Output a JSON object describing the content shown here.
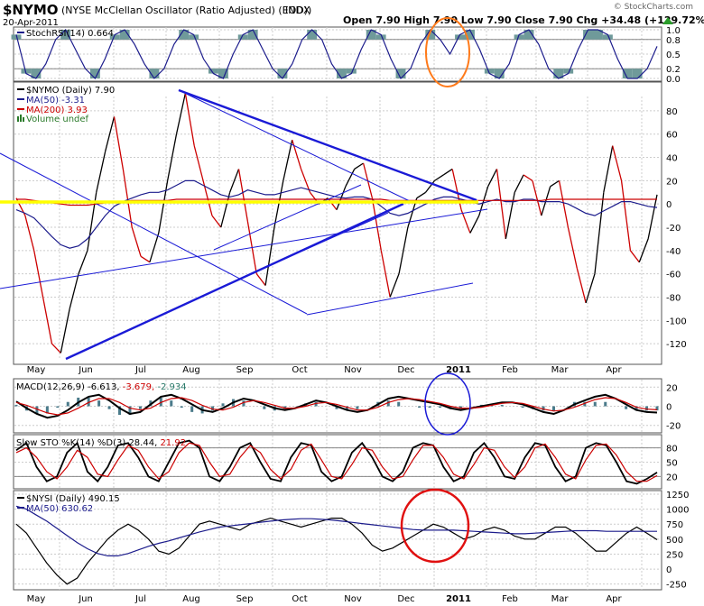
{
  "header": {
    "symbol": "$NYMO",
    "description": "(NYSE McClellan Oscillator (Ratio Adjusted) (EOD))",
    "exchange": "INDX",
    "date": "20-Apr-2011",
    "quote": "Open 7.90  High 7.90  Low 7.90  Close 7.90  Chg +34.48 (+129.72%)",
    "watermark": "© StockCharts.com",
    "up_arrow_color": "#2a9d2a"
  },
  "x_axis": {
    "months": [
      "May",
      "Jun",
      "Jul",
      "Aug",
      "Sep",
      "Oct",
      "Nov",
      "Dec",
      "2011",
      "Feb",
      "Mar",
      "Apr"
    ]
  },
  "panels": {
    "stochrsi": {
      "legend": "StochRSI(14) 0.664",
      "ticks": [
        "1.0",
        "0.8",
        "0.5",
        "0.2",
        "0.0"
      ]
    },
    "nymo": {
      "legend_main": "$NYMO (Daily) 7.90",
      "legend_ma50": "MA(50) -3.31",
      "legend_ma200": "MA(200) 3.93",
      "legend_volume": "Volume undef",
      "ticks": [
        "80",
        "60",
        "40",
        "20",
        "0",
        "-20",
        "-40",
        "-60",
        "-80",
        "-100",
        "-120"
      ]
    },
    "macd": {
      "legend_prefix": "MACD(12,26,9)",
      "legend_v1": "-6.613,",
      "legend_v2": "-3.679,",
      "legend_v3": "-2.934",
      "ticks": [
        "20",
        "0",
        "-20"
      ]
    },
    "sto": {
      "legend_prefix": "Slow STO %K(14) %D(3)",
      "legend_k": "28.44,",
      "legend_d": "21.92",
      "ticks": [
        "80",
        "50",
        "20"
      ]
    },
    "nysi": {
      "legend_main": "$NYSI (Daily) 490.15",
      "legend_ma": "MA(50) 630.62",
      "ticks": [
        "1250",
        "1000",
        "750",
        "500",
        "250",
        "0",
        "-250"
      ]
    }
  },
  "colors": {
    "price": "#000000",
    "ma50": "#1c1c8c",
    "ma200": "#cc0000",
    "trendline": "#1a1ad6",
    "zero_line": "#ffff00",
    "stoch_fill": "#6f9a9a",
    "macd_hist": "#4a7a8a",
    "circle_orange": "#ff7a1a",
    "circle_blue": "#1a1ad6",
    "circle_red": "#e01010"
  },
  "chart_data": [
    {
      "type": "line",
      "title": "StochRSI(14)",
      "ylim": [
        0,
        1
      ],
      "series": [
        {
          "name": "StochRSI(14)",
          "values": [
            0.9,
            0.1,
            0.0,
            0.3,
            0.8,
            1.0,
            0.6,
            0.2,
            0.0,
            0.4,
            0.9,
            1.0,
            0.7,
            0.3,
            0.0,
            0.2,
            0.7,
            1.0,
            0.9,
            0.4,
            0.1,
            0.0,
            0.5,
            0.9,
            1.0,
            0.6,
            0.2,
            0.0,
            0.3,
            0.8,
            1.0,
            0.8,
            0.3,
            0.0,
            0.1,
            0.6,
            1.0,
            0.9,
            0.4,
            0.0,
            0.2,
            0.7,
            1.0,
            0.8,
            0.5,
            0.9,
            1.0,
            0.6,
            0.1,
            0.0,
            0.3,
            0.9,
            1.0,
            0.7,
            0.2,
            0.0,
            0.1,
            0.6,
            1.0,
            1.0,
            0.9,
            0.4,
            0.0,
            0.0,
            0.2,
            0.66
          ]
        }
      ]
    },
    {
      "type": "line",
      "title": "$NYMO (Daily)",
      "ylim": [
        -130,
        90
      ],
      "series": [
        {
          "name": "$NYMO",
          "values": [
            5,
            -10,
            -40,
            -80,
            -120,
            -128,
            -90,
            -60,
            -40,
            10,
            45,
            75,
            30,
            -20,
            -45,
            -50,
            -25,
            20,
            60,
            95,
            50,
            20,
            -10,
            -20,
            10,
            30,
            -15,
            -60,
            -70,
            -20,
            20,
            55,
            30,
            10,
            0,
            5,
            -5,
            15,
            30,
            35,
            5,
            -40,
            -80,
            -60,
            -20,
            5,
            10,
            20,
            25,
            30,
            -5,
            -25,
            -10,
            15,
            30,
            -30,
            10,
            25,
            20,
            -10,
            15,
            20,
            -20,
            -55,
            -85,
            -60,
            10,
            50,
            20,
            -40,
            -50,
            -30,
            8
          ]
        },
        {
          "name": "MA(50)",
          "values": [
            -5,
            -8,
            -12,
            -20,
            -28,
            -35,
            -38,
            -36,
            -30,
            -20,
            -10,
            -2,
            2,
            5,
            8,
            10,
            10,
            12,
            16,
            20,
            20,
            16,
            12,
            8,
            6,
            8,
            12,
            10,
            8,
            8,
            10,
            12,
            14,
            12,
            10,
            8,
            6,
            5,
            6,
            6,
            4,
            -2,
            -8,
            -10,
            -8,
            -4,
            0,
            4,
            6,
            6,
            4,
            2,
            0,
            2,
            4,
            2,
            2,
            4,
            4,
            2,
            2,
            2,
            0,
            -4,
            -8,
            -10,
            -6,
            -2,
            2,
            2,
            0,
            -2,
            -3
          ]
        },
        {
          "name": "MA(200)",
          "values": [
            4,
            4,
            3,
            2,
            1,
            0,
            -1,
            -1,
            -1,
            0,
            1,
            2,
            2,
            3,
            3,
            3,
            3,
            3,
            4,
            4,
            4,
            4,
            4,
            4,
            4,
            4,
            4,
            4,
            4,
            4,
            4,
            4,
            4,
            4,
            4,
            4,
            4,
            4,
            4,
            4,
            4,
            4,
            3,
            3,
            3,
            3,
            3,
            3,
            3,
            3,
            3,
            3,
            3,
            3,
            3,
            3,
            3,
            3,
            3,
            3,
            4,
            4,
            4,
            4,
            4,
            4,
            4,
            4,
            4,
            4,
            4,
            4,
            4
          ]
        }
      ]
    },
    {
      "type": "line",
      "title": "MACD(12,26,9)",
      "ylim": [
        -25,
        25
      ],
      "series": [
        {
          "name": "MACD",
          "values": [
            5,
            -2,
            -8,
            -12,
            -10,
            -4,
            4,
            10,
            12,
            6,
            -2,
            -8,
            -6,
            2,
            10,
            12,
            8,
            2,
            -4,
            -6,
            -2,
            4,
            8,
            6,
            2,
            -2,
            -4,
            -2,
            2,
            6,
            4,
            0,
            -4,
            -6,
            -4,
            2,
            8,
            10,
            8,
            6,
            4,
            2,
            -2,
            -4,
            -2,
            0,
            2,
            4,
            4,
            2,
            -2,
            -6,
            -8,
            -4,
            2,
            6,
            10,
            12,
            8,
            2,
            -4,
            -6,
            -6.6
          ]
        },
        {
          "name": "Signal",
          "values": [
            4,
            1,
            -3,
            -7,
            -9,
            -7,
            -2,
            4,
            8,
            8,
            4,
            -2,
            -4,
            -2,
            4,
            8,
            9,
            6,
            1,
            -3,
            -4,
            -1,
            4,
            6,
            4,
            1,
            -2,
            -2,
            0,
            3,
            4,
            2,
            -1,
            -4,
            -4,
            -1,
            4,
            7,
            8,
            7,
            5,
            3,
            0,
            -2,
            -2,
            -1,
            1,
            3,
            4,
            3,
            0,
            -3,
            -5,
            -4,
            -1,
            3,
            7,
            9,
            8,
            4,
            -1,
            -3,
            -3.7
          ]
        }
      ]
    },
    {
      "type": "line",
      "title": "Slow STO %K(14) %D(3)",
      "ylim": [
        0,
        100
      ],
      "series": [
        {
          "name": "%K",
          "values": [
            75,
            90,
            40,
            10,
            20,
            70,
            90,
            30,
            10,
            40,
            85,
            90,
            60,
            20,
            10,
            50,
            90,
            95,
            80,
            20,
            10,
            40,
            80,
            90,
            50,
            15,
            10,
            60,
            90,
            85,
            30,
            10,
            20,
            70,
            90,
            60,
            20,
            10,
            30,
            80,
            90,
            85,
            40,
            10,
            20,
            70,
            90,
            60,
            20,
            15,
            60,
            90,
            85,
            40,
            10,
            20,
            80,
            90,
            85,
            50,
            10,
            5,
            15,
            28.44
          ]
        },
        {
          "name": "%D",
          "values": [
            70,
            80,
            60,
            30,
            15,
            40,
            75,
            60,
            25,
            20,
            55,
            85,
            75,
            40,
            15,
            30,
            70,
            90,
            85,
            50,
            20,
            25,
            60,
            85,
            70,
            35,
            15,
            35,
            75,
            88,
            55,
            20,
            15,
            45,
            80,
            75,
            40,
            15,
            20,
            55,
            85,
            85,
            60,
            25,
            15,
            45,
            80,
            75,
            40,
            18,
            40,
            80,
            88,
            60,
            25,
            15,
            55,
            85,
            88,
            65,
            30,
            10,
            10,
            21.92
          ]
        }
      ]
    },
    {
      "type": "line",
      "title": "$NYSI (Daily)",
      "ylim": [
        -300,
        1250
      ],
      "series": [
        {
          "name": "$NYSI",
          "values": [
            750,
            600,
            350,
            100,
            -100,
            -250,
            -150,
            100,
            300,
            500,
            650,
            750,
            650,
            500,
            300,
            250,
            350,
            550,
            750,
            800,
            750,
            700,
            650,
            750,
            800,
            850,
            800,
            750,
            700,
            750,
            800,
            850,
            850,
            750,
            600,
            400,
            300,
            350,
            450,
            550,
            650,
            750,
            700,
            600,
            500,
            550,
            650,
            700,
            650,
            550,
            500,
            500,
            600,
            700,
            700,
            600,
            450,
            300,
            300,
            450,
            600,
            700,
            600,
            490
          ]
        },
        {
          "name": "MA(50)",
          "values": [
            1050,
            1000,
            900,
            800,
            680,
            560,
            440,
            340,
            260,
            220,
            220,
            260,
            320,
            380,
            430,
            470,
            520,
            570,
            620,
            660,
            700,
            720,
            740,
            760,
            780,
            800,
            820,
            830,
            840,
            840,
            830,
            820,
            800,
            780,
            760,
            740,
            720,
            700,
            680,
            660,
            650,
            650,
            650,
            650,
            640,
            630,
            620,
            610,
            600,
            590,
            590,
            600,
            610,
            620,
            630,
            640,
            640,
            640,
            630,
            630,
            630,
            630,
            630,
            630
          ]
        }
      ]
    }
  ]
}
